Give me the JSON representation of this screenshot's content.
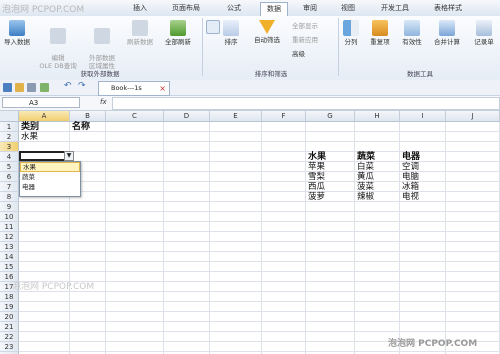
{
  "watermark": {
    "top": "泡泡网 PCPOP.COM",
    "bottom": "泡泡网 PCPOP.COM"
  },
  "ribbon_tabs": [
    {
      "label": "插入"
    },
    {
      "label": "页面布局"
    },
    {
      "label": "公式"
    },
    {
      "label": "数据"
    },
    {
      "label": "审阅"
    },
    {
      "label": "视图"
    },
    {
      "label": "开发工具"
    },
    {
      "label": "表格样式"
    }
  ],
  "ribbon": {
    "import_data": "导入数据",
    "edit_odbc": "编辑\nOLE DB查询",
    "external_data": "外部数据\n区域属性",
    "refresh_data": "刷新数据",
    "refresh_all": "全部刷新",
    "group_external": "获取外部数据",
    "sort": "排序",
    "auto_filter": "自动筛选",
    "show_all": "全部显示",
    "reapply": "重新应用",
    "advanced": "高级",
    "group_sort": "排序和筛选",
    "split": "分列",
    "duplicates": "重复项",
    "validity": "有效性",
    "consolidate": "合并计算",
    "record_list": "记录单",
    "group_tools": "数据工具"
  },
  "quick_access": {
    "doc_tab": "Book---1s"
  },
  "formula_bar": {
    "name_box": "A3",
    "fx": "fx"
  },
  "columns": [
    "A",
    "B",
    "C",
    "D",
    "E",
    "F",
    "G",
    "H",
    "I",
    "J"
  ],
  "rows": [
    "1",
    "2",
    "3",
    "4",
    "5",
    "6",
    "7",
    "8",
    "9",
    "10",
    "11",
    "12",
    "13",
    "14",
    "15",
    "16",
    "17",
    "18",
    "19",
    "20",
    "21",
    "22",
    "23",
    "24"
  ],
  "cells": {
    "A1": "类别",
    "B1": "名称",
    "A2": "水果",
    "G4": "水果",
    "H4": "蔬菜",
    "I4": "电器",
    "G5": "苹果",
    "H5": "白菜",
    "I5": "空调",
    "G6": "雪梨",
    "H6": "黄瓜",
    "I6": "电脑",
    "G7": "西瓜",
    "H7": "菠菜",
    "I7": "冰箱",
    "G8": "菠萝",
    "H8": "辣椒",
    "I8": "电视"
  },
  "dropdown_options": [
    "水果",
    "蔬菜",
    "电器"
  ]
}
